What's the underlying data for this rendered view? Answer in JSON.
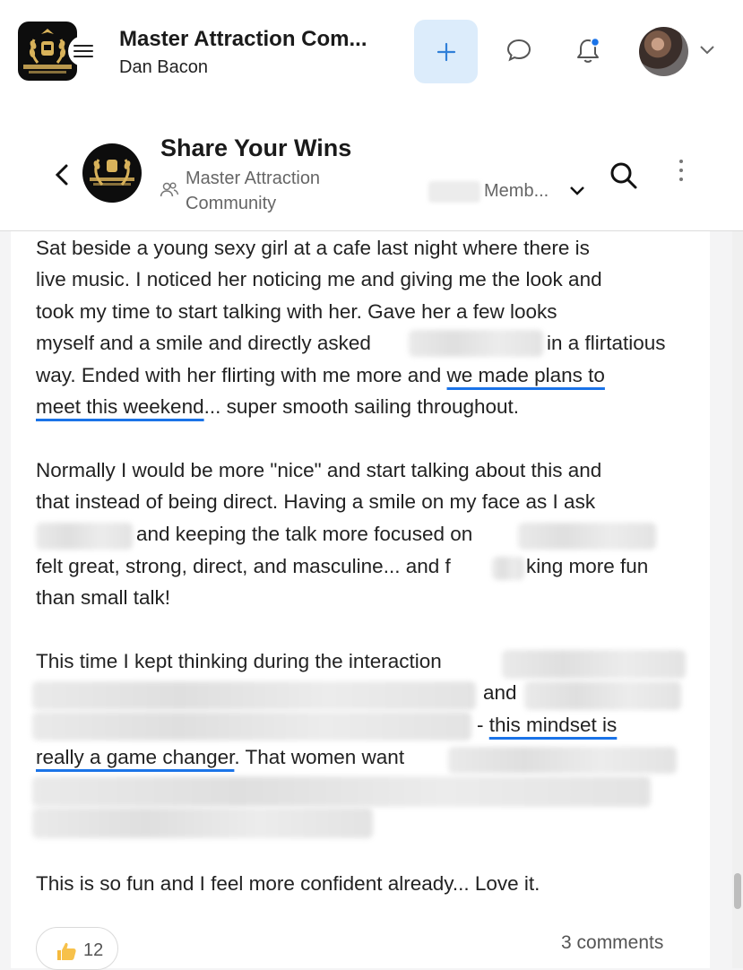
{
  "header": {
    "app_title": "Master Attraction Com...",
    "user_name": "Dan Bacon",
    "add_label": "+",
    "icons": [
      "hamburger-icon",
      "chat-icon",
      "bell-icon",
      "chevron-down-icon"
    ],
    "accent": "#2f7fd8",
    "notification_dot": "#1a73e8"
  },
  "group": {
    "title": "Share Your Wins",
    "community": "Master Attraction Community",
    "members_label": "Memb...",
    "logo_text": "MASTER ATTRACTION COMMUNITY"
  },
  "post": {
    "p1": [
      "Sat beside a young sexy girl at a cafe last night where there is",
      "live music. I noticed her noticing me and giving me the look and",
      "took my time to start talking with her. Gave her a few looks",
      "myself and a smile and directly asked",
      "in a flirtatious",
      "way. Ended with her flirting with me more and ",
      "we made plans to",
      "meet this weekend",
      "... super smooth sailing throughout."
    ],
    "p2": [
      "Normally I would be more \"nice\" and start talking about this and",
      "that instead of being direct. Having a smile on my face as I ask",
      "and keeping the talk more focused on",
      "felt great, strong, direct, and masculine... and f",
      "king more fun",
      "than small talk!"
    ],
    "p3": [
      "This time I kept thinking during the interaction",
      "and",
      "- ",
      "this mindset is",
      "really a game changer",
      ". That women want"
    ],
    "p4": "This is so fun and I feel more confident already... Love it.",
    "reaction_count": "12",
    "comments": "3 comments",
    "underline_color": "#1a73e8"
  }
}
